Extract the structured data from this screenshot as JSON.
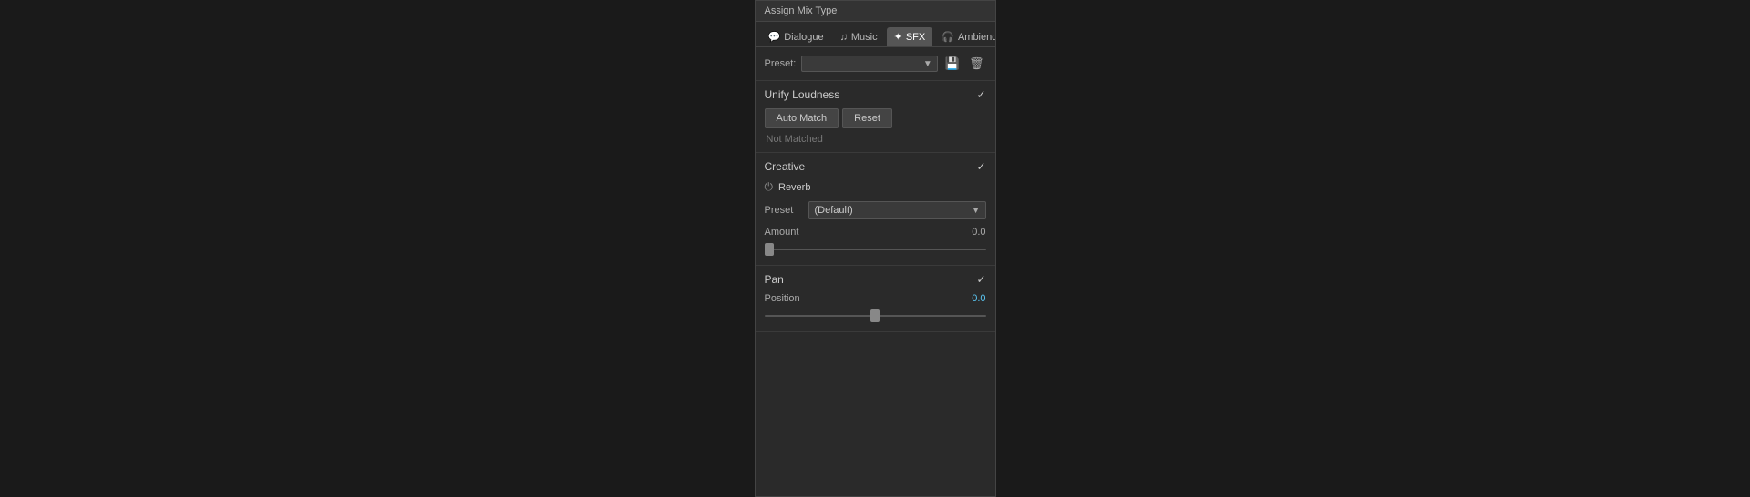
{
  "panel": {
    "title": "Assign Mix Type",
    "tabs": [
      {
        "id": "dialogue",
        "label": "Dialogue",
        "icon": "💬",
        "active": false
      },
      {
        "id": "music",
        "label": "Music",
        "icon": "🎵",
        "active": false
      },
      {
        "id": "sfx",
        "label": "SFX",
        "icon": "✦",
        "active": true
      },
      {
        "id": "ambience",
        "label": "Ambience",
        "icon": "🎧",
        "active": false
      }
    ],
    "preset": {
      "label": "Preset:",
      "value": "",
      "placeholder": ""
    },
    "sections": {
      "unify_loudness": {
        "title": "Unify Loudness",
        "checked": true,
        "auto_match_label": "Auto Match",
        "reset_label": "Reset",
        "status": "Not Matched"
      },
      "creative": {
        "title": "Creative",
        "checked": true,
        "reverb_label": "Reverb",
        "preset_label": "Preset",
        "preset_value": "(Default)",
        "amount_label": "Amount",
        "amount_value": "0.0"
      },
      "pan": {
        "title": "Pan",
        "checked": true,
        "position_label": "Position",
        "position_value": "0.0"
      }
    }
  }
}
